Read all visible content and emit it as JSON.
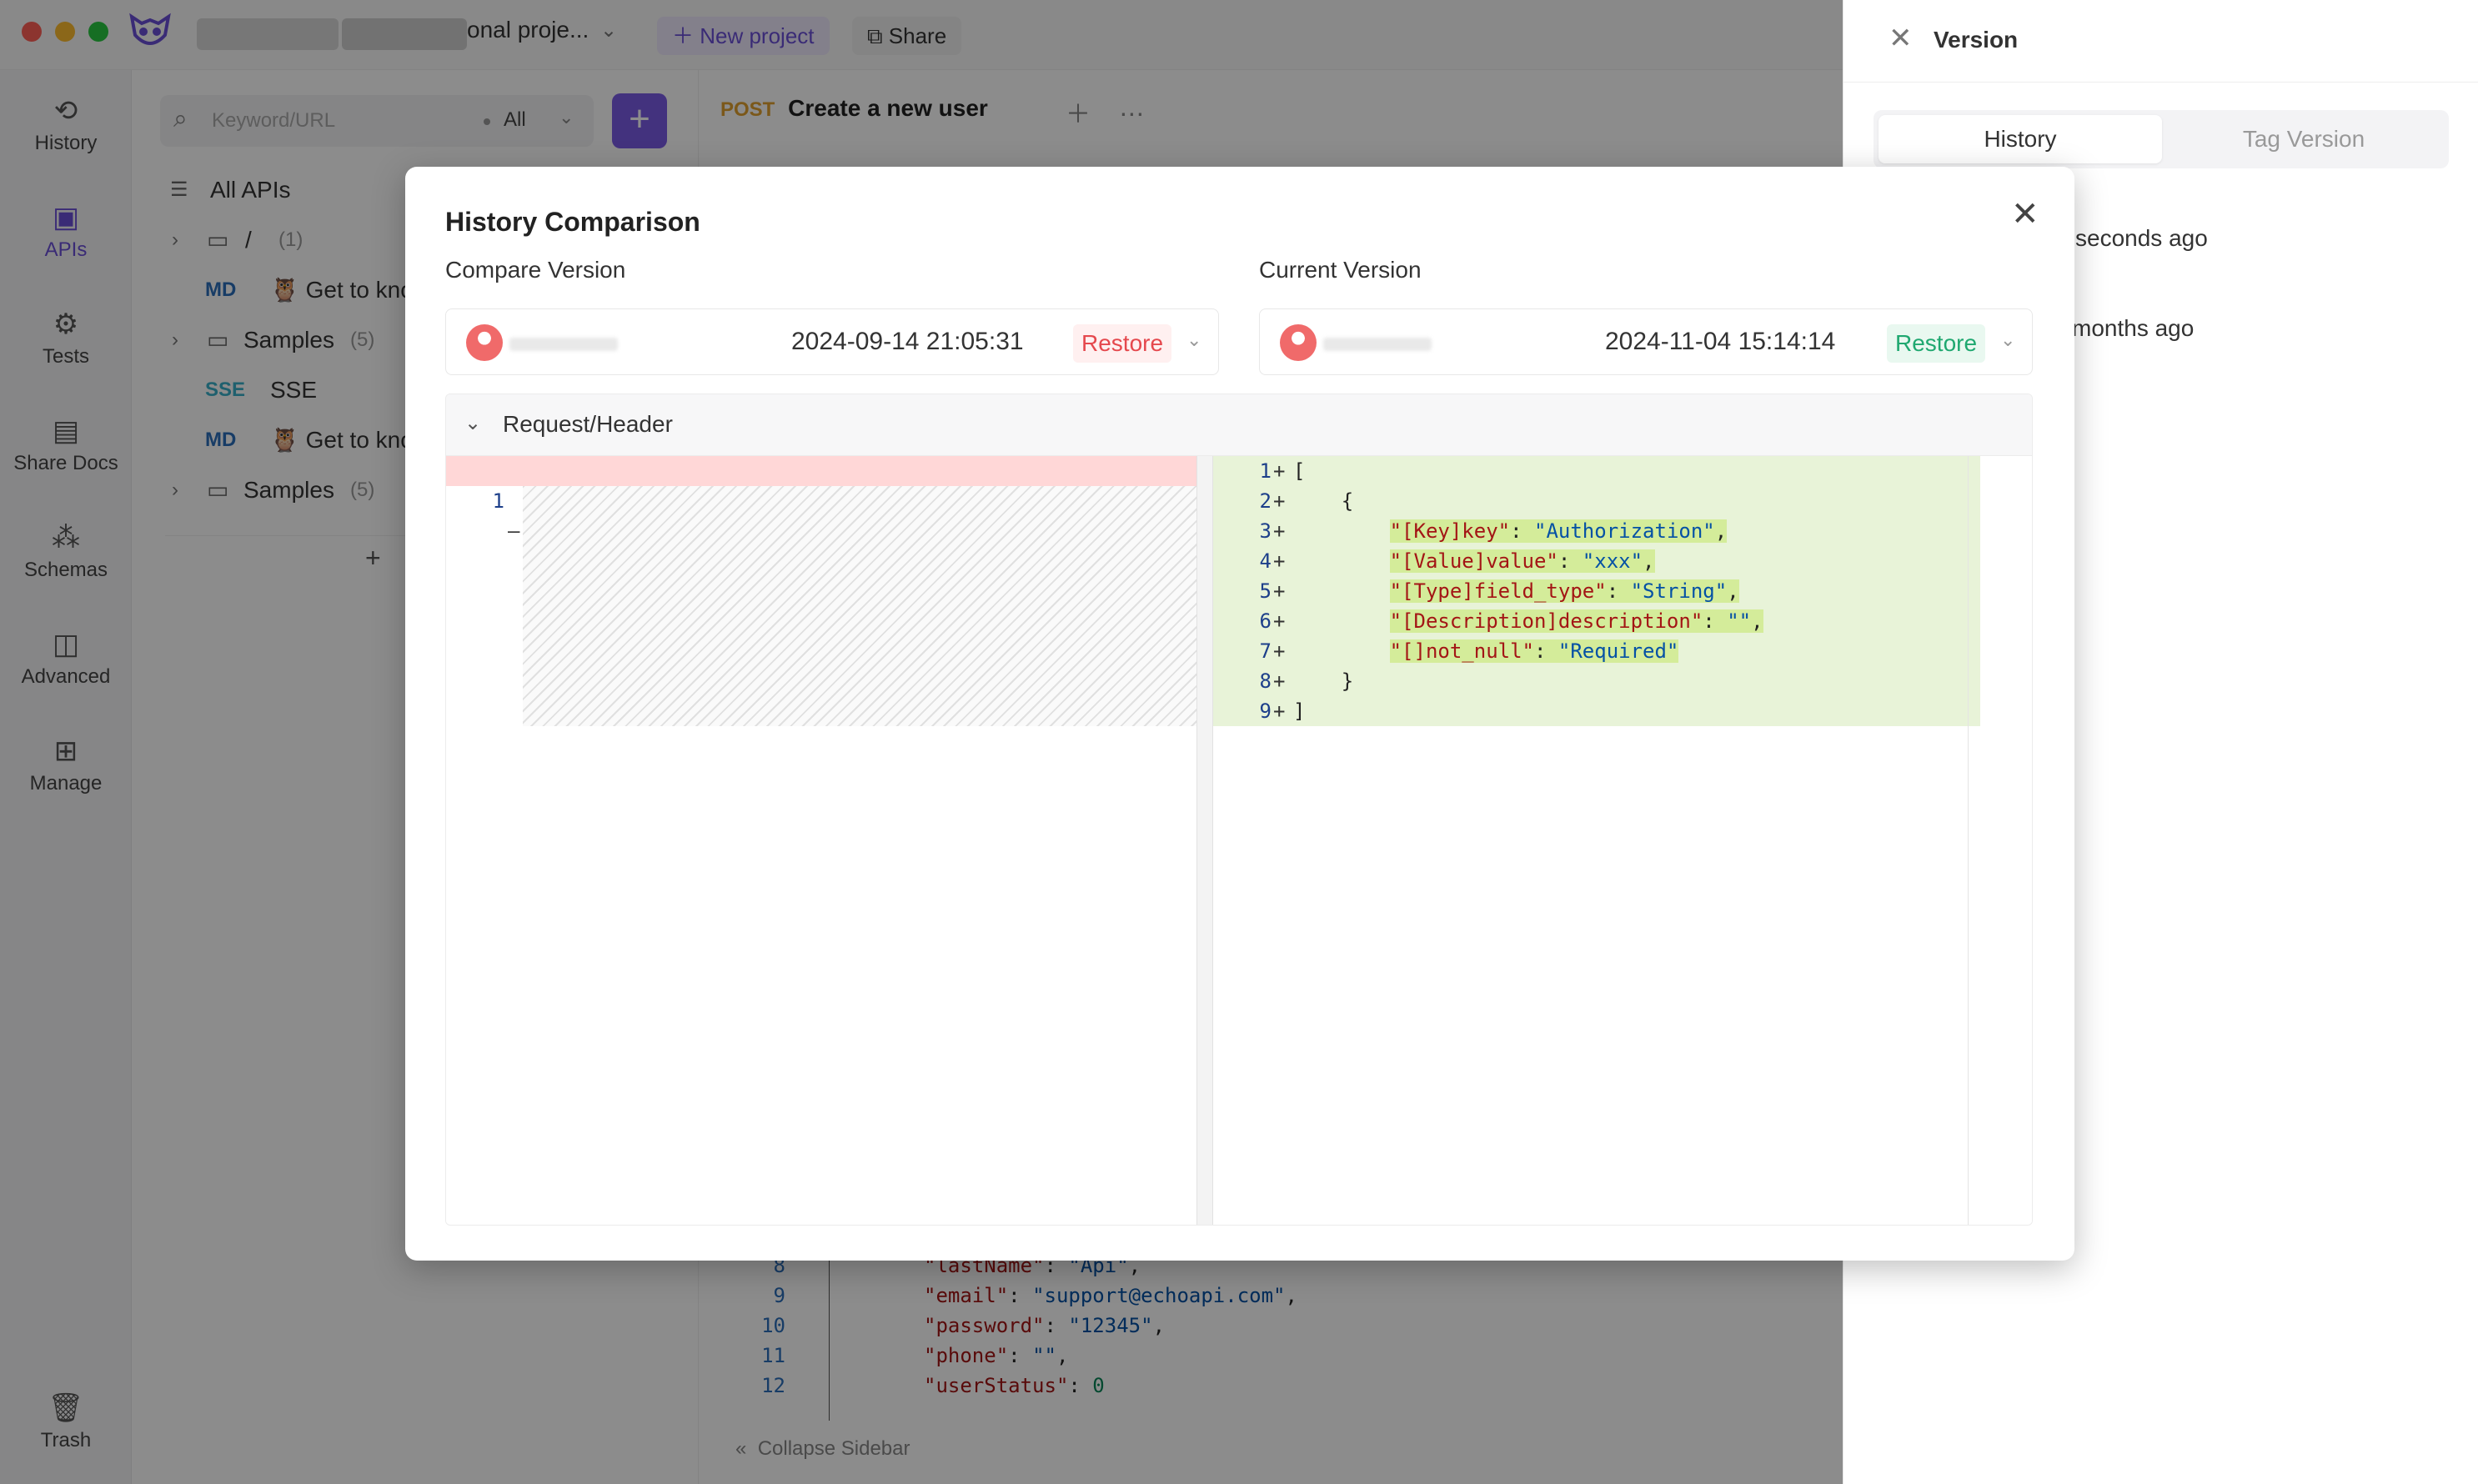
{
  "titlebar": {
    "project_name": "onal proje...",
    "new_project": "New project",
    "share": "Share"
  },
  "nav": [
    {
      "label": "History",
      "icon": "history-icon"
    },
    {
      "label": "APIs",
      "icon": "apis-icon"
    },
    {
      "label": "Tests",
      "icon": "tests-icon"
    },
    {
      "label": "Share Docs",
      "icon": "share-docs-icon"
    },
    {
      "label": "Schemas",
      "icon": "schemas-icon"
    },
    {
      "label": "Advanced",
      "icon": "advanced-icon"
    },
    {
      "label": "Manage",
      "icon": "manage-icon"
    },
    {
      "label": "Trash",
      "icon": "trash-icon"
    }
  ],
  "tree": {
    "search_placeholder": "Keyword/URL",
    "filter_value": "All",
    "all_apis": "All APIs",
    "rows": [
      {
        "tag": "",
        "text": "/",
        "count": "(1)"
      },
      {
        "tag": "MD",
        "text": "🦉 Get to kno",
        "count": ""
      },
      {
        "tag": "",
        "text": "Samples",
        "count": "(5)"
      },
      {
        "tag": "SSE",
        "text": "SSE",
        "count": ""
      },
      {
        "tag": "MD",
        "text": "🦉 Get to kno",
        "count": ""
      },
      {
        "tag": "",
        "text": "Samples",
        "count": "(5)"
      }
    ]
  },
  "main": {
    "method": "POST",
    "request_name": "Create a new user",
    "collapse_sidebar": "Collapse Sidebar",
    "code_lines": [
      {
        "ln": "8",
        "key": "\"lastName\"",
        "val": "\"Api\"",
        "tail": ","
      },
      {
        "ln": "9",
        "key": "\"email\"",
        "val": "\"support@echoapi.com\"",
        "tail": ","
      },
      {
        "ln": "10",
        "key": "\"password\"",
        "val": "\"12345\"",
        "tail": ","
      },
      {
        "ln": "11",
        "key": "\"phone\"",
        "val": "\"\"",
        "tail": ","
      },
      {
        "ln": "12",
        "key": "\"userStatus\"",
        "val": "0",
        "tail": ""
      }
    ]
  },
  "version_panel": {
    "title": "Version",
    "tab_history": "History",
    "tab_tag": "Tag Version",
    "items": [
      "seconds ago",
      "months ago"
    ]
  },
  "modal": {
    "title": "History Comparison",
    "compare_label": "Compare Version",
    "current_label": "Current Version",
    "compare_date": "2024-09-14 21:05:31",
    "current_date": "2024-11-04 15:14:14",
    "restore": "Restore",
    "section": "Request/Header",
    "left_lines": [
      {
        "ln": "1",
        "sign": "—",
        "text": "[]"
      }
    ],
    "right_lines": [
      {
        "ln": "1",
        "sign": "+",
        "text": "["
      },
      {
        "ln": "2",
        "sign": "+",
        "text": "    {"
      },
      {
        "ln": "3",
        "sign": "+",
        "key": "\"[Key]key\"",
        "val": "\"Authorization\"",
        "tail": ","
      },
      {
        "ln": "4",
        "sign": "+",
        "key": "\"[Value]value\"",
        "val": "\"xxx\"",
        "tail": ","
      },
      {
        "ln": "5",
        "sign": "+",
        "key": "\"[Type]field_type\"",
        "val": "\"String\"",
        "tail": ","
      },
      {
        "ln": "6",
        "sign": "+",
        "key": "\"[Description]description\"",
        "val": "\"\"",
        "tail": ","
      },
      {
        "ln": "7",
        "sign": "+",
        "key": "\"[]not_null\"",
        "val": "\"Required\"",
        "tail": ""
      },
      {
        "ln": "8",
        "sign": "+",
        "text": "    }"
      },
      {
        "ln": "9",
        "sign": "+",
        "text": "]"
      }
    ]
  },
  "colors": {
    "accent": "#7a5be6",
    "restore_red": "#e5484d",
    "restore_green": "#1fa870",
    "diff_removed": "#ffd7d7",
    "diff_added": "#e8f3d8"
  }
}
